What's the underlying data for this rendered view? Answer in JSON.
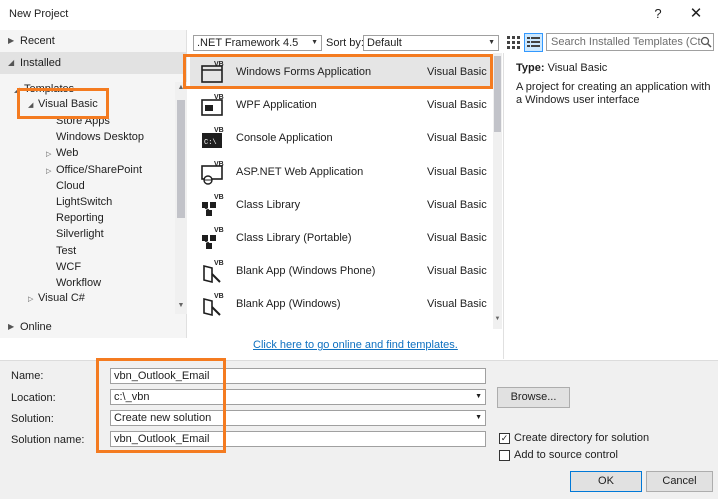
{
  "window": {
    "title": "New Project",
    "help_glyph": "?",
    "close_glyph": "✕"
  },
  "nav": {
    "recent": "Recent",
    "installed": "Installed",
    "templates": "Templates",
    "visual_basic": "Visual Basic",
    "vb_children": [
      "Store Apps",
      "Windows Desktop",
      "Web",
      "Office/SharePoint",
      "Cloud",
      "LightSwitch",
      "Reporting",
      "Silverlight",
      "Test",
      "WCF",
      "Workflow"
    ],
    "visual_csharp": "Visual C#",
    "online": "Online"
  },
  "toolbar": {
    "framework": ".NET Framework 4.5",
    "sort_label": "Sort by:",
    "sort_value": "Default",
    "search_placeholder": "Search Installed Templates (Ct"
  },
  "templates": [
    {
      "name": "Windows Forms Application",
      "lang": "Visual Basic",
      "icon": "windows-forms-icon",
      "selected": true
    },
    {
      "name": "WPF Application",
      "lang": "Visual Basic",
      "icon": "wpf-icon"
    },
    {
      "name": "Console Application",
      "lang": "Visual Basic",
      "icon": "console-icon"
    },
    {
      "name": "ASP.NET Web Application",
      "lang": "Visual Basic",
      "icon": "web-icon"
    },
    {
      "name": "Class Library",
      "lang": "Visual Basic",
      "icon": "class-library-icon"
    },
    {
      "name": "Class Library (Portable)",
      "lang": "Visual Basic",
      "icon": "portable-library-icon"
    },
    {
      "name": "Blank App (Windows Phone)",
      "lang": "Visual Basic",
      "icon": "phone-app-icon"
    },
    {
      "name": "Blank App (Windows)",
      "lang": "Visual Basic",
      "icon": "windows-app-icon"
    }
  ],
  "online_link": "Click here to go online and find templates.",
  "details": {
    "type_label": "Type:",
    "type_value": "Visual Basic",
    "description": "A project for creating an application with a Windows user interface"
  },
  "form": {
    "name_label": "Name:",
    "name_value": "vbn_Outlook_Email",
    "location_label": "Location:",
    "location_value": "c:\\_vbn",
    "solution_label": "Solution:",
    "solution_value": "Create new solution",
    "solution_name_label": "Solution name:",
    "solution_name_value": "vbn_Outlook_Email",
    "browse": "Browse...",
    "create_dir": "Create directory for solution",
    "create_dir_checked": true,
    "add_source": "Add to source control",
    "add_source_checked": false,
    "ok": "OK",
    "cancel": "Cancel"
  },
  "colors": {
    "highlight": "#f47b20",
    "link": "#0e70c0",
    "selected_row": "#e5e5e5"
  }
}
